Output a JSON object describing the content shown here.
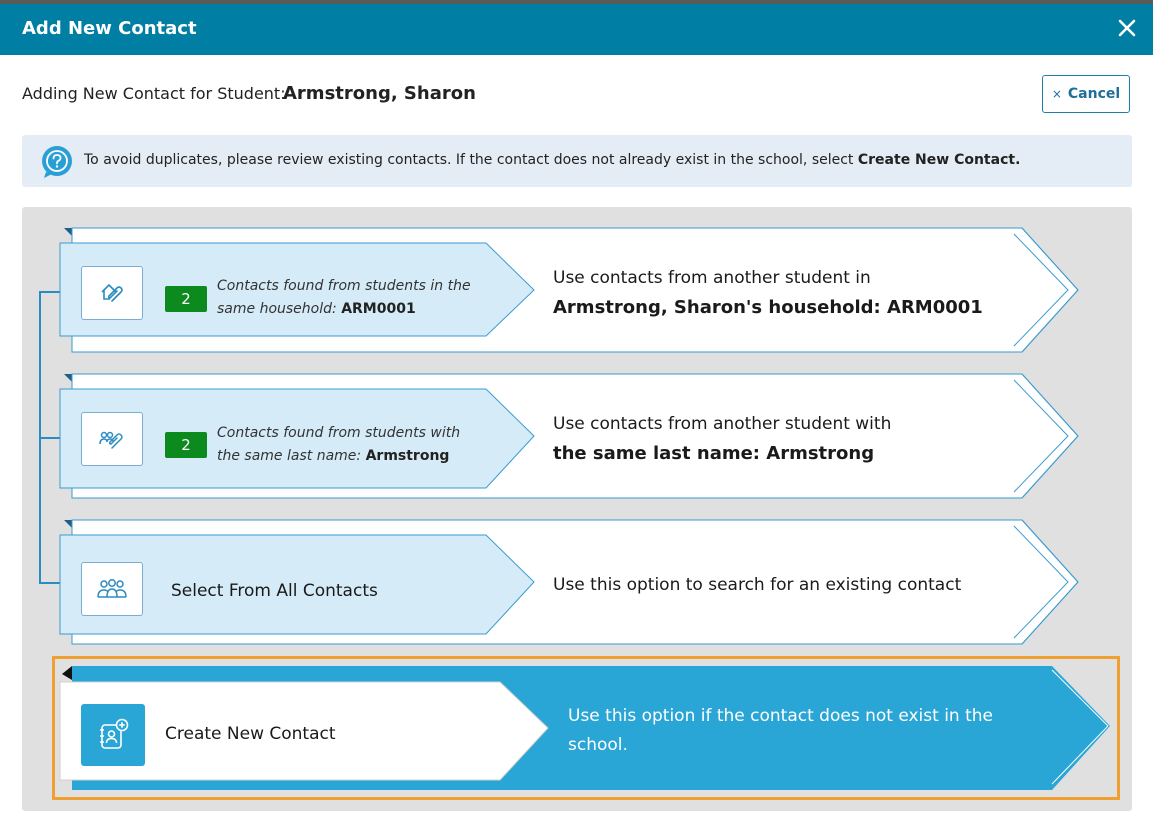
{
  "dialog": {
    "title": "Add New Contact",
    "close_icon": "close-icon"
  },
  "student": {
    "label": "Adding New Contact for Student:",
    "name": "Armstrong, Sharon"
  },
  "cancel": {
    "label": "Cancel",
    "icon": "×"
  },
  "info": {
    "text": "To avoid duplicates, please review existing contacts. If the contact does not already exist in the school, select ",
    "bold": "Create New Contact."
  },
  "options": [
    {
      "icon": "household-link-icon",
      "count": "2",
      "desc": "Contacts found from students in the same household: ",
      "desc_bold": "ARM0001",
      "right_line1": "Use contacts from another student in",
      "right_line2": "Armstrong, Sharon's household: ARM0001"
    },
    {
      "icon": "people-link-icon",
      "count": "2",
      "desc": "Contacts found from students with the same last name: ",
      "desc_bold": "Armstrong",
      "right_line1": "Use contacts from another student with",
      "right_line2": "the same last name: Armstrong"
    },
    {
      "icon": "group-icon",
      "label": "Select From All Contacts",
      "right_line1": "Use this option to search for an existing contact"
    },
    {
      "icon": "address-book-add-icon",
      "label": "Create New Contact",
      "right_line1": "Use this option if the contact does not exist in the",
      "right_line2": "school."
    }
  ],
  "colors": {
    "header": "#007ea3",
    "accent": "#2aa6d6",
    "badge": "#0c8a1d",
    "highlight": "#f0a030"
  }
}
